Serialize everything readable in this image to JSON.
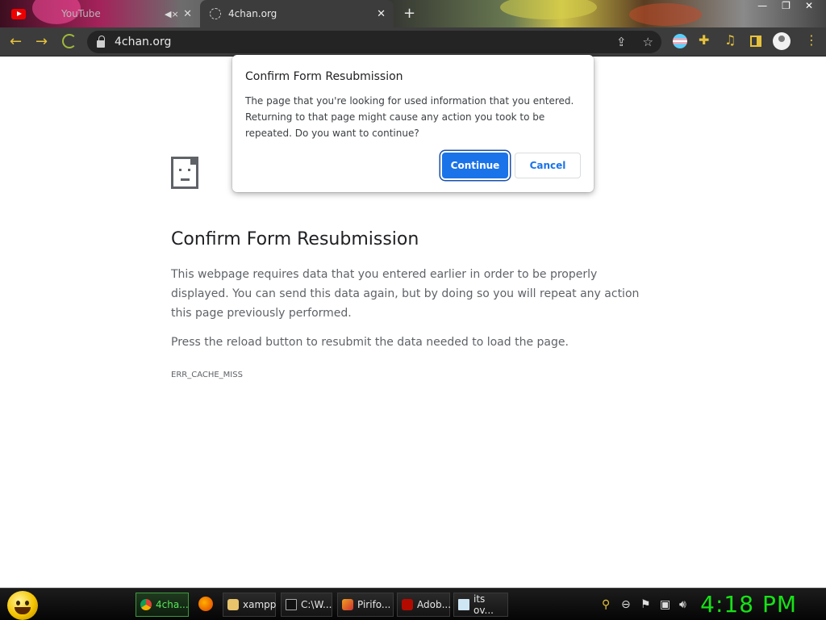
{
  "tabs": [
    {
      "title": "YouTube",
      "icon": "youtube-icon",
      "muted": true,
      "active": false
    },
    {
      "title": "4chan.org",
      "icon": "globe-icon",
      "active": true
    }
  ],
  "toolbar": {
    "url": "4chan.org",
    "omnibox_icons": [
      "share-icon",
      "star-icon"
    ],
    "extensions": [
      "trans-flag-icon",
      "puzzle-icon",
      "media-icon",
      "side-panel-icon",
      "profile-icon",
      "menu-icon"
    ]
  },
  "error_page": {
    "icon": "sad-page-icon",
    "title": "Confirm Form Resubmission",
    "body": "This webpage requires data that you entered earlier in order to be properly displayed. You can send this data again, but by doing so you will repeat any action this page previously performed.",
    "hint": "Press the reload button to resubmit the data needed to load the page.",
    "code": "ERR_CACHE_MISS"
  },
  "dialog": {
    "title": "Confirm Form Resubmission",
    "message": "The page that you're looking for used information that you entered. Returning to that page might cause any action you took to be repeated. Do you want to continue?",
    "continue_label": "Continue",
    "cancel_label": "Cancel"
  },
  "taskbar": {
    "start_icon": "smiley-icon",
    "buttons": [
      {
        "label": "4cha...",
        "icon": "chrome-icon",
        "active": true
      },
      {
        "label": "",
        "icon": "firefox-icon",
        "active": false
      },
      {
        "label": "xampp",
        "icon": "folder-icon",
        "active": false
      },
      {
        "label": "C:\\W...",
        "icon": "cmd-icon",
        "active": false
      },
      {
        "label": "Pirifo...",
        "icon": "piriform-icon",
        "active": false
      },
      {
        "label": "Adob...",
        "icon": "adobe-icon",
        "active": false
      },
      {
        "label": "its ov...",
        "icon": "notepad-icon",
        "active": false
      }
    ],
    "tray_icons": [
      "search-icon",
      "minus-circle-icon",
      "action-center-flag-icon",
      "network-icon",
      "volume-icon"
    ],
    "clock": "4:18 PM"
  },
  "colors": {
    "accent": "#1a73e8",
    "toolbar_icon": "#e6c23c",
    "clock": "#17e217"
  }
}
